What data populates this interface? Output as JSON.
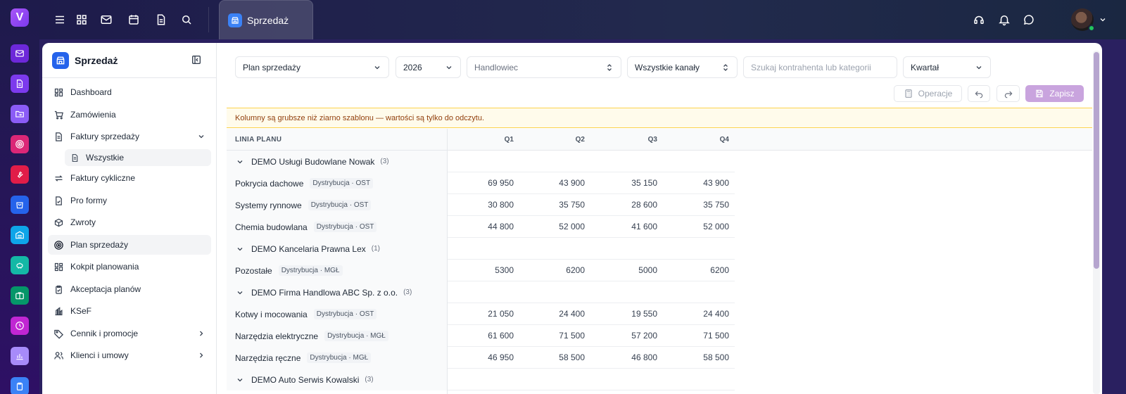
{
  "app": {
    "logo_letter": "V",
    "accent": "#7c3aed",
    "rail_icons": [
      {
        "icon": "mail-icon",
        "color": "#6d28d9"
      },
      {
        "icon": "document-icon",
        "color": "#7c3aed"
      },
      {
        "icon": "folder-transfer-icon",
        "color": "#8b5cf6"
      },
      {
        "icon": "target-icon",
        "color": "#db2777"
      },
      {
        "icon": "wrench-icon",
        "color": "#e11d48"
      },
      {
        "icon": "shopping-bag-icon",
        "color": "#2563eb"
      },
      {
        "icon": "warehouse-icon",
        "color": "#0ea5e9"
      },
      {
        "icon": "piggy-bank-icon",
        "color": "#14b8a6"
      },
      {
        "icon": "briefcase-icon",
        "color": "#059669"
      },
      {
        "icon": "clock-icon",
        "color": "#c026d3"
      },
      {
        "icon": "bar-chart-icon",
        "color": "#a78bfa"
      },
      {
        "icon": "clipboard-icon",
        "color": "#3b82f6"
      }
    ]
  },
  "topbar": {
    "active_tab": "Sprzedaż"
  },
  "sidebar": {
    "title": "Sprzedaż",
    "items": [
      {
        "label": "Dashboard",
        "icon": "dashboard-icon"
      },
      {
        "label": "Zamówienia",
        "icon": "cart-icon"
      },
      {
        "label": "Faktury sprzedaży",
        "icon": "invoice-icon",
        "expanded": true
      },
      {
        "label": "Wszystkie",
        "icon": "document-icon",
        "sub": true
      },
      {
        "label": "Faktury cykliczne",
        "icon": "repeat-icon"
      },
      {
        "label": "Pro formy",
        "icon": "proforma-icon"
      },
      {
        "label": "Zwroty",
        "icon": "return-box-icon"
      },
      {
        "label": "Plan sprzedaży",
        "icon": "target-icon",
        "active": true
      },
      {
        "label": "Kokpit planowania",
        "icon": "dashboard-icon"
      },
      {
        "label": "Akceptacja planów",
        "icon": "clipboard-check-icon"
      },
      {
        "label": "KSeF",
        "icon": "ksef-icon"
      },
      {
        "label": "Cennik i promocje",
        "icon": "tag-icon",
        "has_children": true
      },
      {
        "label": "Klienci i umowy",
        "icon": "users-icon",
        "has_children": true
      }
    ]
  },
  "filters": {
    "plan": "Plan sprzedaży",
    "year": "2026",
    "salesperson_placeholder": "Handlowiec",
    "channels": "Wszystkie kanały",
    "search_placeholder": "Szukaj kontrahenta lub kategorii",
    "period": "Kwartał"
  },
  "toolbar": {
    "operations": "Operacje",
    "save": "Zapisz"
  },
  "notice": "Kolumny są grubsze niż ziarno szablonu — wartości są tylko do odczytu.",
  "table": {
    "headers": [
      "LINIA PLANU",
      "Q1",
      "Q2",
      "Q3",
      "Q4"
    ],
    "groups": [
      {
        "name": "DEMO Usługi Budowlane Nowak",
        "count": "(3)",
        "rows": [
          {
            "name": "Pokrycia dachowe",
            "tag": "Dystrybucja · OST",
            "q": [
              "69 950",
              "43 900",
              "35 150",
              "43 900"
            ]
          },
          {
            "name": "Systemy rynnowe",
            "tag": "Dystrybucja · OST",
            "q": [
              "30 800",
              "35 750",
              "28 600",
              "35 750"
            ]
          },
          {
            "name": "Chemia budowlana",
            "tag": "Dystrybucja · OST",
            "q": [
              "44 800",
              "52 000",
              "41 600",
              "52 000"
            ]
          }
        ]
      },
      {
        "name": "DEMO Kancelaria Prawna Lex",
        "count": "(1)",
        "rows": [
          {
            "name": "Pozostałe",
            "tag": "Dystrybucja · MGŁ",
            "q": [
              "5300",
              "6200",
              "5000",
              "6200"
            ]
          }
        ]
      },
      {
        "name": "DEMO Firma Handlowa ABC Sp. z o.o.",
        "count": "(3)",
        "rows": [
          {
            "name": "Kotwy i mocowania",
            "tag": "Dystrybucja · OST",
            "q": [
              "21 050",
              "24 400",
              "19 550",
              "24 400"
            ]
          },
          {
            "name": "Narzędzia elektryczne",
            "tag": "Dystrybucja · MGŁ",
            "q": [
              "61 600",
              "71 500",
              "57 200",
              "71 500"
            ]
          },
          {
            "name": "Narzędzia ręczne",
            "tag": "Dystrybucja · MGŁ",
            "q": [
              "46 950",
              "58 500",
              "46 800",
              "58 500"
            ]
          }
        ]
      },
      {
        "name": "DEMO Auto Serwis Kowalski",
        "count": "(3)",
        "rows": []
      }
    ]
  }
}
